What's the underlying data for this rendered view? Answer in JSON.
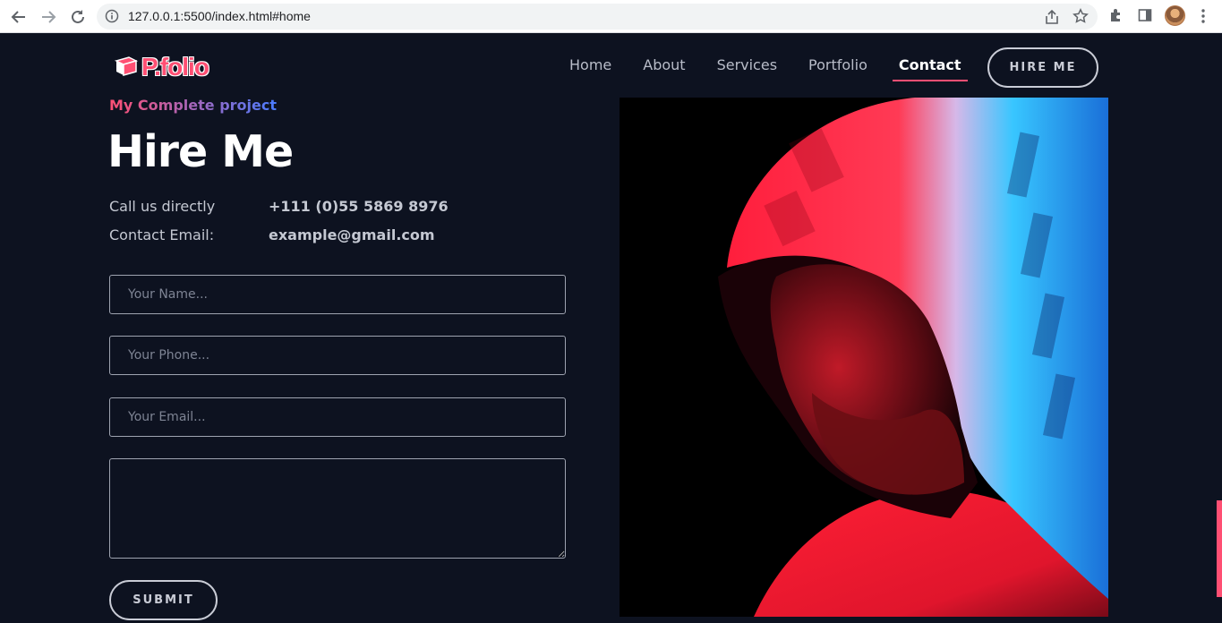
{
  "browser": {
    "url": "127.0.0.1:5500/index.html#home",
    "icons": [
      "back-icon",
      "forward-icon",
      "reload-icon",
      "info-icon",
      "share-icon",
      "star-icon",
      "extensions-icon",
      "side-panel-icon",
      "profile-avatar",
      "menu-icon"
    ]
  },
  "brand": {
    "logo_text": "P.folio",
    "accent": "#ff4f73",
    "bg": "#0d1220"
  },
  "nav": {
    "items": [
      {
        "label": "Home",
        "active": false
      },
      {
        "label": "About",
        "active": false
      },
      {
        "label": "Services",
        "active": false
      },
      {
        "label": "Portfolio",
        "active": false
      },
      {
        "label": "Contact",
        "active": true
      }
    ],
    "hire_label": "HIRE ME"
  },
  "hero": {
    "subtitle": "My Complete project",
    "title": "Hire Me",
    "call_label": "Call us directly",
    "call_value": "+111 (0)55 5869 8976",
    "email_label": "Contact Email:",
    "email_value": "example@gmail.com"
  },
  "form": {
    "name_placeholder": "Your Name...",
    "phone_placeholder": "Your Phone...",
    "email_placeholder": "Your Email...",
    "message_value": "",
    "submit_label": "SUBMIT"
  }
}
